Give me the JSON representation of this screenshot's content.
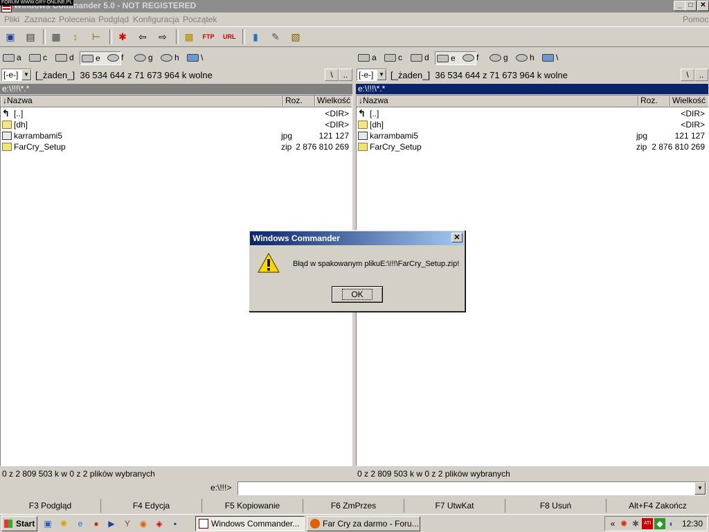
{
  "window": {
    "title": "Windows Commander 5.0 - NOT REGISTERED",
    "watermark": "FORUM WWW.GRY-ONLINE.PL",
    "controls": [
      "_",
      "□",
      "✕"
    ]
  },
  "menu": {
    "items": [
      "Pliki",
      "Zaznacz",
      "Polecenia",
      "Podgląd",
      "Konfiguracja",
      "Początek"
    ],
    "help": "Pomoc"
  },
  "drives": [
    "a",
    "c",
    "d",
    "e",
    "f",
    "g",
    "h",
    "\\"
  ],
  "selected_drive": "e",
  "panels": {
    "left": {
      "combo": "[-e-]",
      "label": "[_żaden_]",
      "free_space": "36 534 644 z 71 673 964 k wolne",
      "btn_root": "\\",
      "btn_up": "..",
      "path": "e:\\!!!\\*.*",
      "active": false,
      "columns": {
        "name": "↓Nazwa",
        "ext": "Roz.",
        "size": "Wielkość"
      },
      "files": [
        {
          "name": "[..]",
          "ext": "",
          "size": "<DIR>",
          "icon": "up-icon"
        },
        {
          "name": "[dh]",
          "ext": "",
          "size": "<DIR>",
          "icon": "folder-icon"
        },
        {
          "name": "karrambami5",
          "ext": "jpg",
          "size": "121 127",
          "icon": "image-file-icon"
        },
        {
          "name": "FarCry_Setup",
          "ext": "zip",
          "size": "2 876 810 269",
          "icon": "archive-icon"
        }
      ],
      "status": "0 z 2 809 503 k w 0 z 2 plików wybranych"
    },
    "right": {
      "combo": "[-e-]",
      "label": "[_żaden_]",
      "free_space": "36 534 644 z 71 673 964 k wolne",
      "btn_root": "\\",
      "btn_up": "..",
      "path": "e:\\!!!\\*.*",
      "active": true,
      "columns": {
        "name": "↓Nazwa",
        "ext": "Roz.",
        "size": "Wielkość"
      },
      "files": [
        {
          "name": "[..]",
          "ext": "",
          "size": "<DIR>",
          "icon": "up-icon"
        },
        {
          "name": "[dh]",
          "ext": "",
          "size": "<DIR>",
          "icon": "folder-icon"
        },
        {
          "name": "karrambami5",
          "ext": "jpg",
          "size": "121 127",
          "icon": "image-file-icon"
        },
        {
          "name": "FarCry_Setup",
          "ext": "zip",
          "size": "2 876 810 269",
          "icon": "archive-icon"
        }
      ],
      "status": "0 z 2 809 503 k w 0 z 2 plików wybranych"
    }
  },
  "command_line": {
    "prompt": "e:\\!!!>",
    "value": ""
  },
  "function_keys": [
    "F3 Podgląd",
    "F4 Edycja",
    "F5 Kopiowanie",
    "F6 ZmPrzes",
    "F7 UtwKat",
    "F8 Usuń",
    "Alt+F4 Zakończ"
  ],
  "dialog": {
    "title": "Windows Commander",
    "message": "Błąd w spakowanym plikuE:\\!!!\\FarCry_Setup.zip!",
    "ok_label": "OK",
    "close": "✕",
    "icon": "warning-icon"
  },
  "taskbar": {
    "start_label": "Start",
    "tasks": [
      {
        "label": "Windows Commander...",
        "active": true
      },
      {
        "label": "Far Cry za darmo - Foru...",
        "active": false
      }
    ],
    "tray_chevron": "«",
    "clock": "12:30"
  },
  "colors": {
    "face": "#d4d0c8",
    "active_path": "#0a246a",
    "inactive_path": "#808080"
  }
}
